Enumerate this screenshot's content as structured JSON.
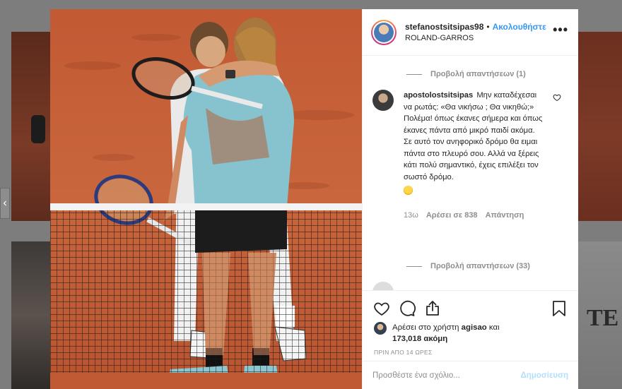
{
  "post": {
    "username": "stefanostsitsipas98",
    "separator": "•",
    "follow_label": "Ακολουθήστε",
    "location": "ROLAND-GARROS",
    "more_label": "•••"
  },
  "photo": {
    "alt": "Two tennis players embracing at the net on a clay court"
  },
  "comments": {
    "view_replies_top": "Προβολή απαντήσεων (1)",
    "item": {
      "username": "apostolostsitsipas",
      "text": "Μην καταδέχεσαι να ρωτάς: «Θα νικήσω ; Θα νικηθώ;» Πολέμα! όπως έκανες σήμερα και όπως έκανες πάντα από μικρό παιδί ακόμα.\nΣε αυτό τον ανηφορικό δρόμο θα ειμαι πάντα στο πλευρό σου. Αλλά να ξέρεις κάτι πολύ σημαντικό, έχεις επιλέξει τον σωστό δρόμο.",
      "emoji": "face-with-tongue-emoji",
      "time": "13ω",
      "likes": "Αρέσει σε 838",
      "reply_label": "Απάντηση"
    },
    "view_replies_bottom": "Προβολή απαντήσεων (33)"
  },
  "actions": {
    "icons": [
      "heart-icon",
      "comment-icon",
      "share-icon",
      "bookmark-icon"
    ]
  },
  "likes": {
    "prefix": "Αρέσει στο χρήστη",
    "user": "agisao",
    "conj": "και",
    "count": "173,018 ακόμη"
  },
  "timestamp": "ΠΡΙΝ ΑΠΟ 14 ΩΡΕΣ",
  "add_comment": {
    "placeholder": "Προσθέστε ένα σχόλιο...",
    "post_label": "Δημοσίευση"
  },
  "nav": {
    "prev_arrow": "‹"
  },
  "colors": {
    "accent": "#3897f0",
    "post_disabled": "#b2dffc",
    "muted": "#8e8e8e",
    "clay": "#c0603c"
  }
}
